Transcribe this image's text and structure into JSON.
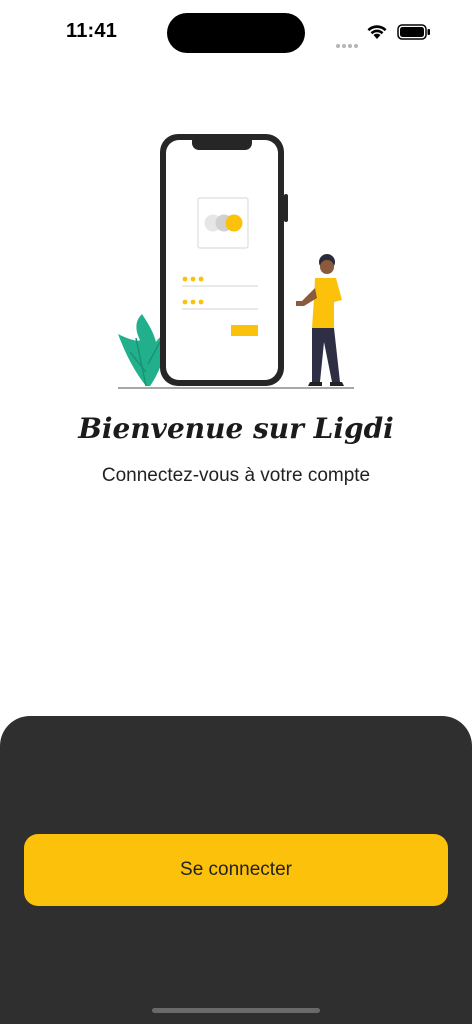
{
  "status_bar": {
    "time": "11:41"
  },
  "welcome": {
    "title": "Bienvenue sur Ligdi",
    "subtitle": "Connectez-vous à votre compte"
  },
  "login_button": {
    "label": "Se connecter"
  },
  "colors": {
    "accent": "#fcc10a",
    "sheet_background": "#2f2f2f",
    "leaf": "#22b08c",
    "phone_frame": "#262626"
  },
  "icons": [
    "signal-icon",
    "wifi-icon",
    "battery-icon",
    "welcome-illustration"
  ]
}
